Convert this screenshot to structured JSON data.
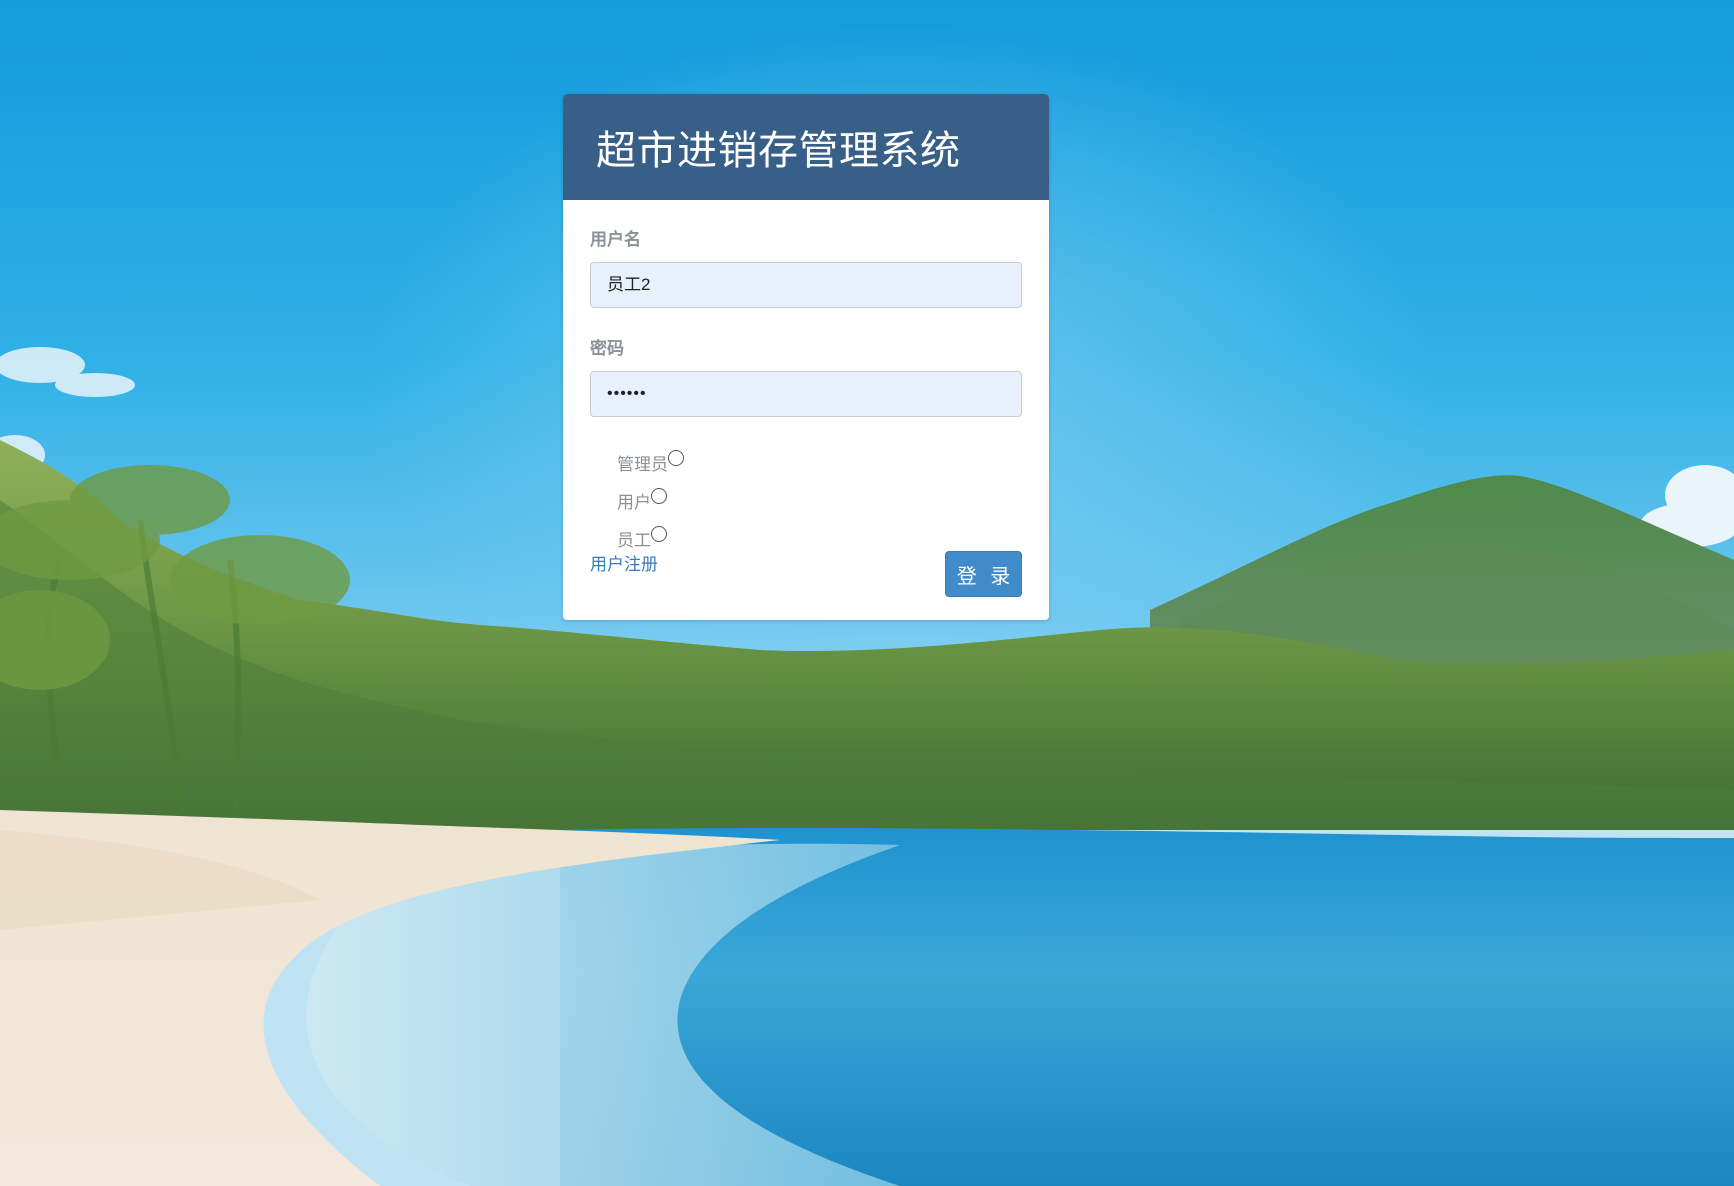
{
  "app": {
    "title": "超市进销存管理系统"
  },
  "form": {
    "username_label": "用户名",
    "username_value": "员工2",
    "password_label": "密码",
    "password_value": "••••••",
    "roles": [
      {
        "label": "管理员",
        "checked": false
      },
      {
        "label": "用户",
        "checked": false
      },
      {
        "label": "员工",
        "checked": false
      }
    ],
    "register_link": "用户注册",
    "login_button": "登 录"
  },
  "colors": {
    "header_bg": "#385f87",
    "button_bg": "#428bca",
    "link": "#3a7bbf",
    "input_bg": "#e8f0fe"
  }
}
